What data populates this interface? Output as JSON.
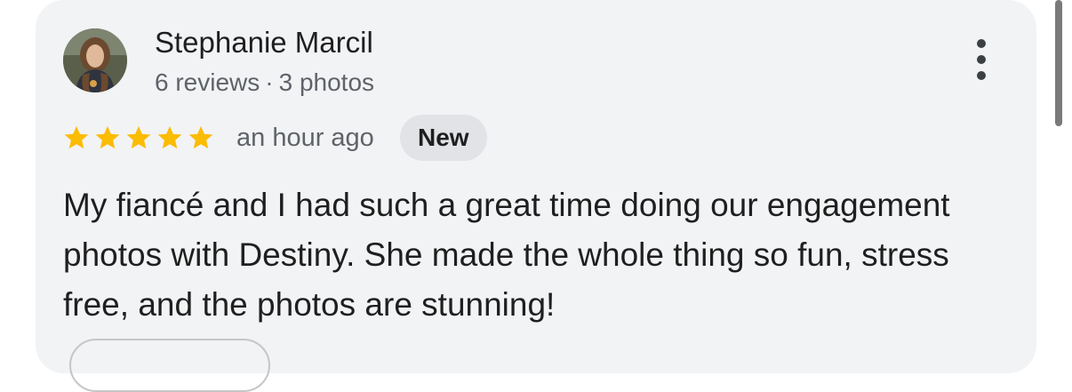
{
  "review": {
    "author": {
      "name": "Stephanie Marcil",
      "reviews_count": "6 reviews",
      "separator": "·",
      "photos_count": "3 photos"
    },
    "rating": 5,
    "rating_max": 5,
    "time_ago": "an hour ago",
    "badge": "New",
    "text": "My fiancé and I had such a great time doing our engagement photos with Destiny. She made the whole thing so fun, stress free, and the photos are stunning!"
  },
  "icons": {
    "more": "more-vertical-icon",
    "star": "star-icon"
  },
  "colors": {
    "card_background": "#f2f3f5",
    "star": "#fbbc04",
    "badge_background": "#e1e3e6",
    "primary_text": "#1f1f1f",
    "secondary_text": "#5f6368"
  }
}
